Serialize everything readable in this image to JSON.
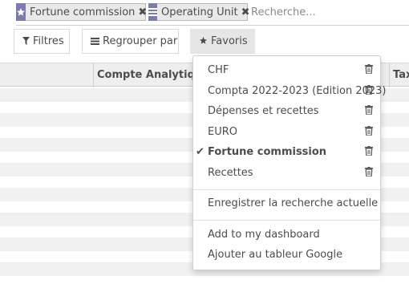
{
  "search": {
    "facets": [
      {
        "icon": "star-icon",
        "label": "Fortune commission"
      },
      {
        "icon": "list-icon",
        "label": "Operating Unit"
      }
    ],
    "placeholder": "Recherche..."
  },
  "toolbar": {
    "filters_label": "Filtres",
    "group_by_label": "Regrouper par",
    "favorites_label": "Favoris"
  },
  "table": {
    "columns": [
      "Compte Analytique",
      "Tax"
    ]
  },
  "favorites_menu": {
    "items": [
      {
        "label": "CHF",
        "selected": false
      },
      {
        "label": "Compta 2022-2023 (Edition 2023)",
        "selected": false
      },
      {
        "label": "Dépenses et recettes",
        "selected": false
      },
      {
        "label": "EURO",
        "selected": false
      },
      {
        "label": "Fortune commission",
        "selected": true
      },
      {
        "label": "Recettes",
        "selected": false
      }
    ],
    "save_current_label": "Enregistrer la recherche actuelle",
    "add_dashboard_label": "Add to my dashboard",
    "add_google_label": "Ajouter au tableur Google"
  },
  "colors": {
    "facet_icon_bg": "#7c7bad",
    "header_bg": "#eeeeee",
    "row_bg": "#f1f1f1"
  }
}
